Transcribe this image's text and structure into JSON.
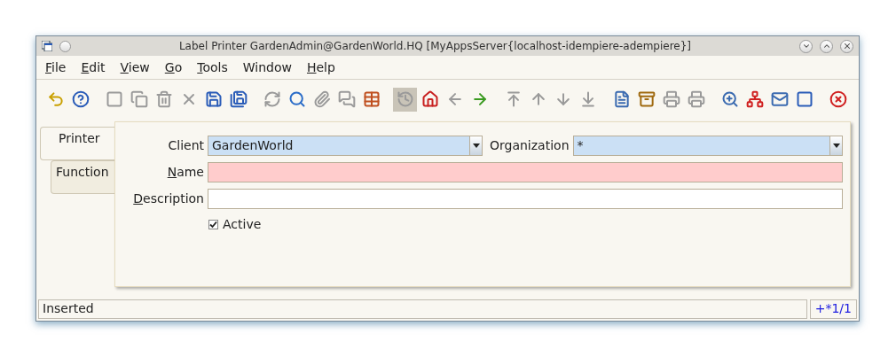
{
  "window": {
    "title": "Label Printer  GardenAdmin@GardenWorld.HQ [MyAppsServer{localhost-idempiere-adempiere}]"
  },
  "menu": [
    {
      "label": "File",
      "mnemonic": true
    },
    {
      "label": "Edit",
      "mnemonic": true
    },
    {
      "label": "View",
      "mnemonic": true
    },
    {
      "label": "Go",
      "mnemonic": true
    },
    {
      "label": "Tools",
      "mnemonic": true
    },
    {
      "label": "Window",
      "mnemonic": false
    },
    {
      "label": "Help",
      "mnemonic": true
    }
  ],
  "toolbar": [
    {
      "disabled": false,
      "pressed": false
    },
    {
      "disabled": false,
      "pressed": false
    },
    {
      "disabled": true,
      "pressed": false
    },
    {
      "disabled": true,
      "pressed": false
    },
    {
      "disabled": true,
      "pressed": false
    },
    {
      "disabled": true,
      "pressed": false
    },
    {
      "disabled": false,
      "pressed": false
    },
    {
      "disabled": false,
      "pressed": false
    },
    {
      "disabled": true,
      "pressed": false
    },
    {
      "disabled": false,
      "pressed": false
    },
    {
      "disabled": true,
      "pressed": false
    },
    {
      "disabled": true,
      "pressed": false
    },
    {
      "disabled": false,
      "pressed": false
    },
    {
      "disabled": true,
      "pressed": true
    },
    {
      "disabled": false,
      "pressed": false
    },
    {
      "disabled": true,
      "pressed": false
    },
    {
      "disabled": false,
      "pressed": false
    },
    {
      "disabled": true,
      "pressed": false
    },
    {
      "disabled": true,
      "pressed": false
    },
    {
      "disabled": true,
      "pressed": false
    },
    {
      "disabled": true,
      "pressed": false
    },
    {
      "disabled": false,
      "pressed": false
    },
    {
      "disabled": false,
      "pressed": false
    },
    {
      "disabled": true,
      "pressed": false
    },
    {
      "disabled": true,
      "pressed": false
    },
    {
      "disabled": false,
      "pressed": false
    },
    {
      "disabled": false,
      "pressed": false
    },
    {
      "disabled": false,
      "pressed": false
    },
    {
      "disabled": false,
      "pressed": false
    },
    {
      "disabled": false,
      "pressed": false
    }
  ],
  "tabs": [
    {
      "label": "Printer",
      "selected": true
    },
    {
      "label": "Function",
      "selected": false
    }
  ],
  "form": {
    "rows": [
      {
        "fields": [
          {
            "kind": "combo",
            "label": "Client",
            "mnemonic": false,
            "value": "GardenWorld"
          },
          {
            "kind": "combo",
            "label": "Organization",
            "mnemonic": false,
            "value": "*"
          }
        ]
      },
      {
        "fields": [
          {
            "kind": "text",
            "label": "Name",
            "mnemonic": true,
            "mandatory": true
          }
        ]
      },
      {
        "fields": [
          {
            "kind": "text",
            "label": "Description",
            "mnemonic": true,
            "mandatory": false
          }
        ]
      },
      {
        "fields": [
          {
            "kind": "checkbox",
            "label": "Active",
            "checked": true
          }
        ]
      }
    ]
  },
  "status_bar": {
    "message": "Inserted",
    "record": "+*1/1"
  }
}
